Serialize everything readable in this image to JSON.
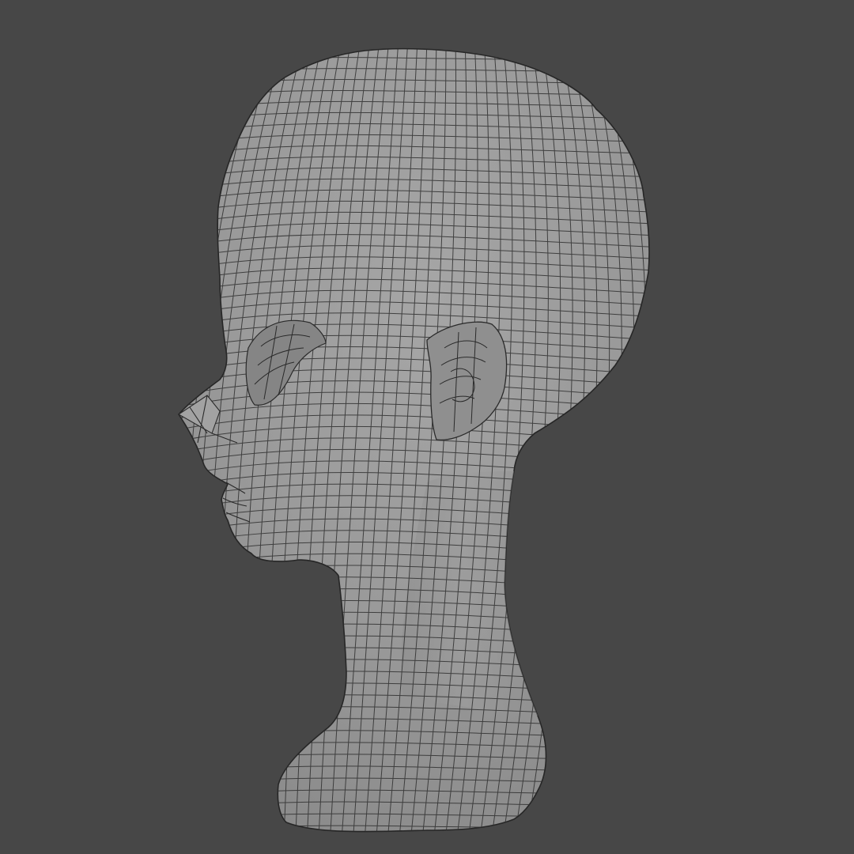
{
  "scene": {
    "subject": "mesh-head",
    "background_color": "#474747",
    "surface_color": "#9c9c9c",
    "wire_color": "#2f2f2f",
    "icons": [
      "mesh-wireframe-icon"
    ]
  }
}
